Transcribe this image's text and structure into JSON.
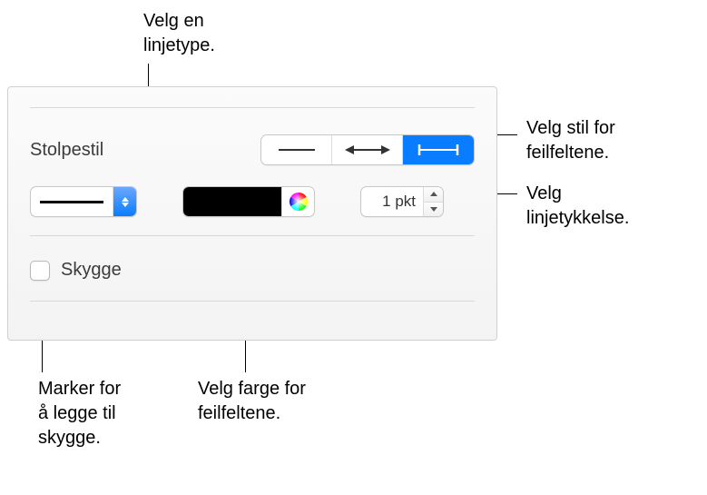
{
  "callouts": {
    "lineType": "Velg en\nlinjetype.",
    "barStyle": "Velg stil for\nfeilfeltene.",
    "thickness": "Velg\nlinjetykkelse.",
    "color": "Velg farge for\nfeilfeltene.",
    "shadow": "Marker for\nå legge til\nskygge."
  },
  "panel": {
    "sectionLabel": "Stolpestil",
    "shadowLabel": "Skygge",
    "thicknessValue": "1 pkt",
    "lineColor": "#000000"
  }
}
